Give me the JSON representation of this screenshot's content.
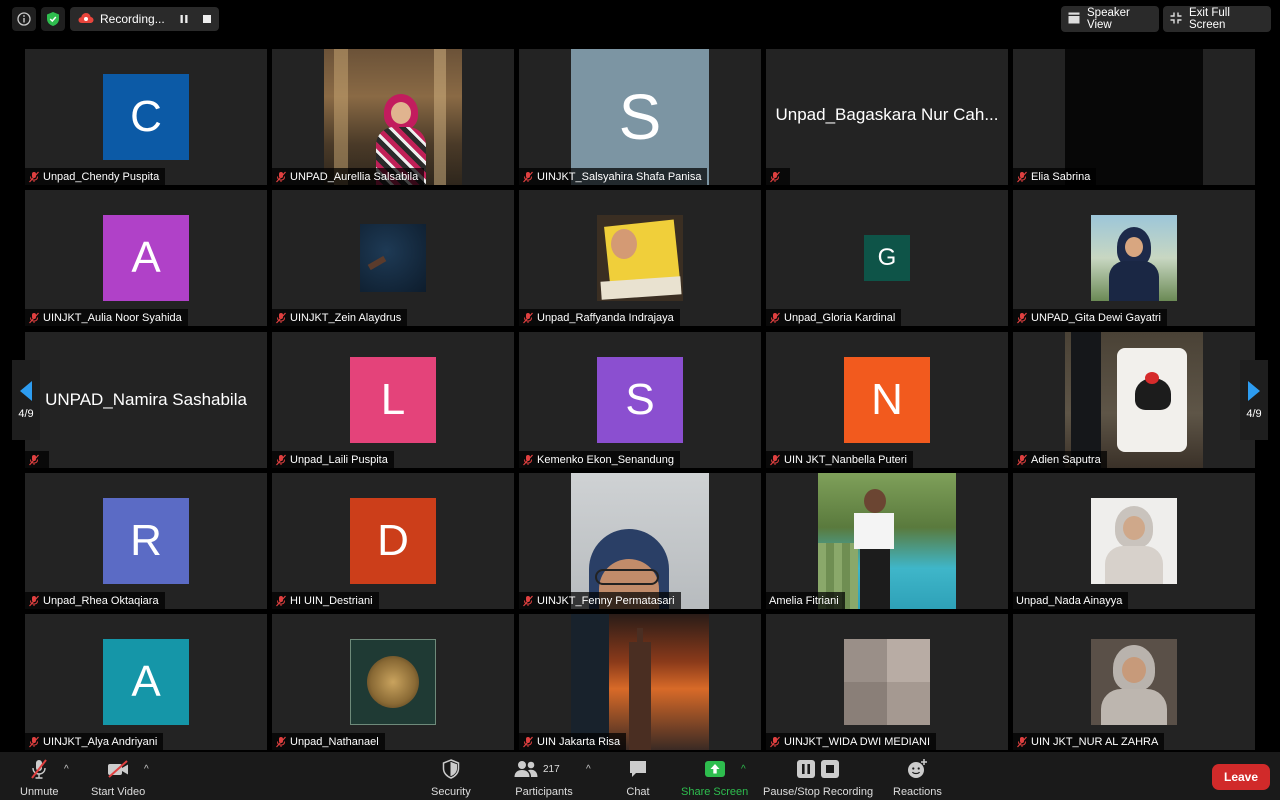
{
  "topbar": {
    "recording_label": "Recording...",
    "speaker_view_label": "Speaker View",
    "exit_fullscreen_label": "Exit Full Screen"
  },
  "participants": [
    {
      "name": "Unpad_Chendy Puspita",
      "avatar_letter": "C",
      "avatar_color": "#0c5aa6"
    },
    {
      "name": "UNPAD_Aurellia Salsabila"
    },
    {
      "name": "UINJKT_Salsyahira Shafa Panisa",
      "avatar_letter": "S",
      "avatar_color": "#7c95a3"
    },
    {
      "name": "",
      "display_name": "Unpad_Bagaskara Nur Cah..."
    },
    {
      "name": "Elia Sabrina"
    },
    {
      "name": "UINJKT_Aulia Noor Syahida",
      "avatar_letter": "A",
      "avatar_color": "#b041c8"
    },
    {
      "name": "UINJKT_Zein Alaydrus"
    },
    {
      "name": "Unpad_Raffyanda Indrajaya"
    },
    {
      "name": "Unpad_Gloria Kardinal",
      "avatar_letter": "G",
      "avatar_color": "#0e5448"
    },
    {
      "name": "UNPAD_Gita Dewi Gayatri"
    },
    {
      "name": "",
      "display_name": "UNPAD_Namira Sashabila"
    },
    {
      "name": "Unpad_Laili Puspita",
      "avatar_letter": "L",
      "avatar_color": "#e4437a"
    },
    {
      "name": "Kemenko Ekon_Senandung",
      "avatar_letter": "S",
      "avatar_color": "#8b4fd0"
    },
    {
      "name": "UIN JKT_Nanbella Puteri",
      "avatar_letter": "N",
      "avatar_color": "#f25a1e"
    },
    {
      "name": "Adien Saputra"
    },
    {
      "name": "Unpad_Rhea Oktaqiara",
      "avatar_letter": "R",
      "avatar_color": "#5b6bc5"
    },
    {
      "name": "HI UIN_Destriani",
      "avatar_letter": "D",
      "avatar_color": "#cc3e1a"
    },
    {
      "name": "UINJKT_Fenny Permatasari"
    },
    {
      "name": "Amelia Fitriani"
    },
    {
      "name": "Unpad_Nada Ainayya"
    },
    {
      "name": "UINJKT_Alya Andriyani",
      "avatar_letter": "A",
      "avatar_color": "#1596a8"
    },
    {
      "name": "Unpad_Nathanael"
    },
    {
      "name": "UIN Jakarta Risa"
    },
    {
      "name": "UINJKT_WIDA DWI MEDIANI"
    },
    {
      "name": "UIN JKT_NUR AL ZAHRA"
    }
  ],
  "pagination": {
    "left": "4/9",
    "right": "4/9"
  },
  "toolbar": {
    "unmute": "Unmute",
    "start_video": "Start Video",
    "security": "Security",
    "participants_count": "217",
    "participants": "Participants",
    "chat": "Chat",
    "share_screen": "Share Screen",
    "pause_stop_recording": "Pause/Stop Recording",
    "reactions": "Reactions",
    "leave": "Leave"
  },
  "colors": {
    "share_green": "#2ebd4e",
    "leave_red": "#d12a2a",
    "muted_red": "#e04040",
    "nav_blue": "#2d9cf0"
  }
}
